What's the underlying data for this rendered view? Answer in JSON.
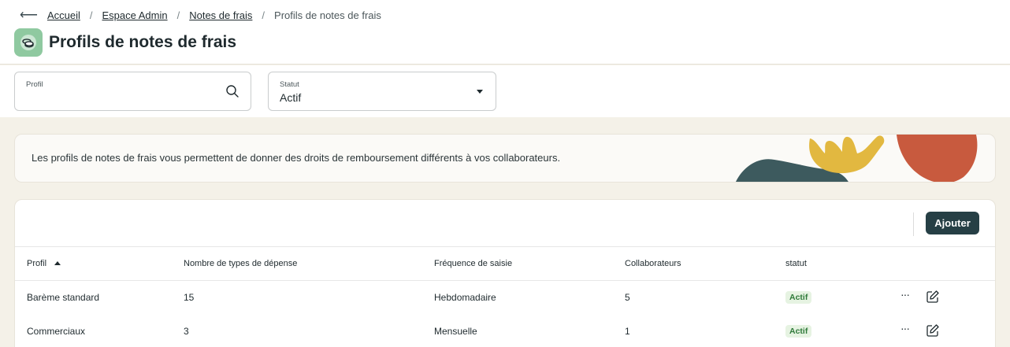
{
  "breadcrumb": {
    "back_icon": "arrow-left-icon",
    "items": [
      "Accueil",
      "Espace Admin",
      "Notes de frais"
    ],
    "current": "Profils de notes de frais",
    "separator": "/"
  },
  "header": {
    "title": "Profils de notes de frais",
    "app_icon": "coins-icon",
    "app_icon_color": "#8fc9a0"
  },
  "filters": {
    "profile": {
      "label": "Profil",
      "value": "",
      "icon": "search-icon"
    },
    "status": {
      "label": "Statut",
      "value": "Actif",
      "icon": "caret-down-icon"
    }
  },
  "info": {
    "text": "Les profils de notes de frais vous permettent de donner des droits de remboursement différents à vos collaborateurs."
  },
  "toolbar": {
    "add_label": "Ajouter"
  },
  "table": {
    "columns": [
      "Profil",
      "Nombre de types de dépense",
      "Fréquence de saisie",
      "Collaborateurs",
      "statut"
    ],
    "sort_column": "Profil",
    "rows": [
      {
        "profil": "Barème standard",
        "types": "15",
        "frequence": "Hebdomadaire",
        "collaborateurs": "5",
        "statut": "Actif"
      },
      {
        "profil": "Commerciaux",
        "types": "3",
        "frequence": "Mensuelle",
        "collaborateurs": "1",
        "statut": "Actif"
      }
    ]
  },
  "colors": {
    "primary_button": "#263f45",
    "status_active_bg": "#e6f3e2",
    "status_active_text": "#2f7a3a",
    "page_background": "#f4f1e8"
  }
}
